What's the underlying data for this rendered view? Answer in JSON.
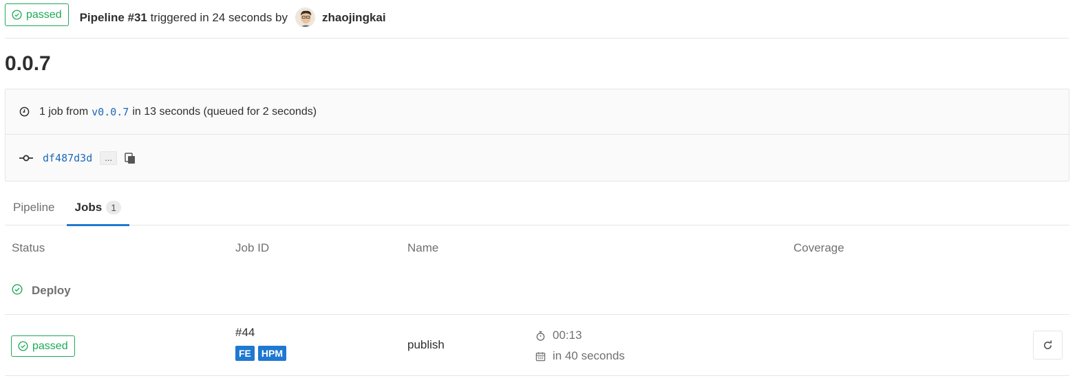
{
  "header": {
    "status": "passed",
    "pipeline_label": "Pipeline #31",
    "triggered_text": "triggered in 24 seconds by",
    "user": "zhaojingkai"
  },
  "title": "0.0.7",
  "info": {
    "jobs_prefix": "1 job from",
    "ref": "v0.0.7",
    "jobs_suffix": "in 13 seconds (queued for 2 seconds)",
    "commit_sha": "df487d3d",
    "ellipsis": "..."
  },
  "tabs": [
    {
      "label": "Pipeline"
    },
    {
      "label": "Jobs",
      "count": "1"
    }
  ],
  "table": {
    "headers": [
      "Status",
      "Job ID",
      "Name",
      "Coverage"
    ],
    "stage": "Deploy",
    "rows": [
      {
        "status": "passed",
        "job_id": "#44",
        "tags": [
          "FE",
          "HPM"
        ],
        "name": "publish",
        "duration": "00:13",
        "finished": "in 40 seconds"
      }
    ]
  },
  "colors": {
    "success": "#1aaa55",
    "link": "#1b69b6",
    "tag": "#1f78d1"
  }
}
